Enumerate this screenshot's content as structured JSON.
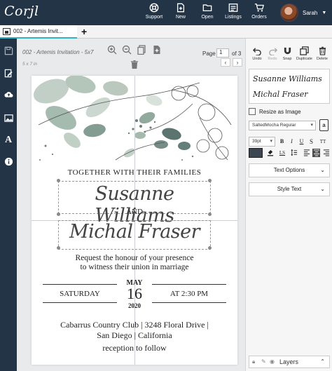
{
  "app": {
    "logo": "Corjl"
  },
  "nav": {
    "items": [
      {
        "label": "Support",
        "icon": "lifebuoy-icon"
      },
      {
        "label": "New",
        "icon": "new-file-icon"
      },
      {
        "label": "Open",
        "icon": "folder-icon"
      },
      {
        "label": "Listings",
        "icon": "listings-icon"
      },
      {
        "label": "Orders",
        "icon": "cart-icon"
      }
    ],
    "user": {
      "name": "Sarah"
    }
  },
  "tabs": {
    "active": "002 - Artemis Invit...",
    "add": "+"
  },
  "document": {
    "title": "002 - Artemis Invitation - 5x7",
    "size": "5 x 7 in",
    "page_label": "Page",
    "page_current": "1",
    "page_of": "of 3"
  },
  "card": {
    "together": "TOGETHER WITH THEIR FAMILIES",
    "name1": "Susanne Williams",
    "and": "AND",
    "name2": "Michal Fraser",
    "request_line1": "Request the honour of your presence",
    "request_line2": "to witness their union in marriage",
    "day": "SATURDAY",
    "month": "MAY",
    "date": "16",
    "year": "2020",
    "time": "AT 2:30 PM",
    "venue_line1": "Cabarrus Country Club | 3248 Floral Drive |",
    "venue_line2": "San Diego | California",
    "reception": "reception to follow"
  },
  "panel": {
    "actions": [
      {
        "label": "Undo",
        "icon": "undo-icon"
      },
      {
        "label": "Redo",
        "icon": "redo-icon"
      },
      {
        "label": "Snap",
        "icon": "magnet-icon"
      },
      {
        "label": "Duplicate",
        "icon": "duplicate-icon"
      },
      {
        "label": "Delete",
        "icon": "trash-icon"
      }
    ],
    "font_preview_1": "Susanne Williams",
    "font_preview_2": "Michal Fraser",
    "resize_label": "Resize as Image",
    "font_name": "SaltedMocha Regular",
    "font_size": "39pt",
    "text_options": "Text Options",
    "style_text": "Style Text",
    "layers": "Layers"
  },
  "colors": {
    "nav_bg": "#243447",
    "accent": "#2fb3c6",
    "text_color_swatch": "#3d4650"
  }
}
